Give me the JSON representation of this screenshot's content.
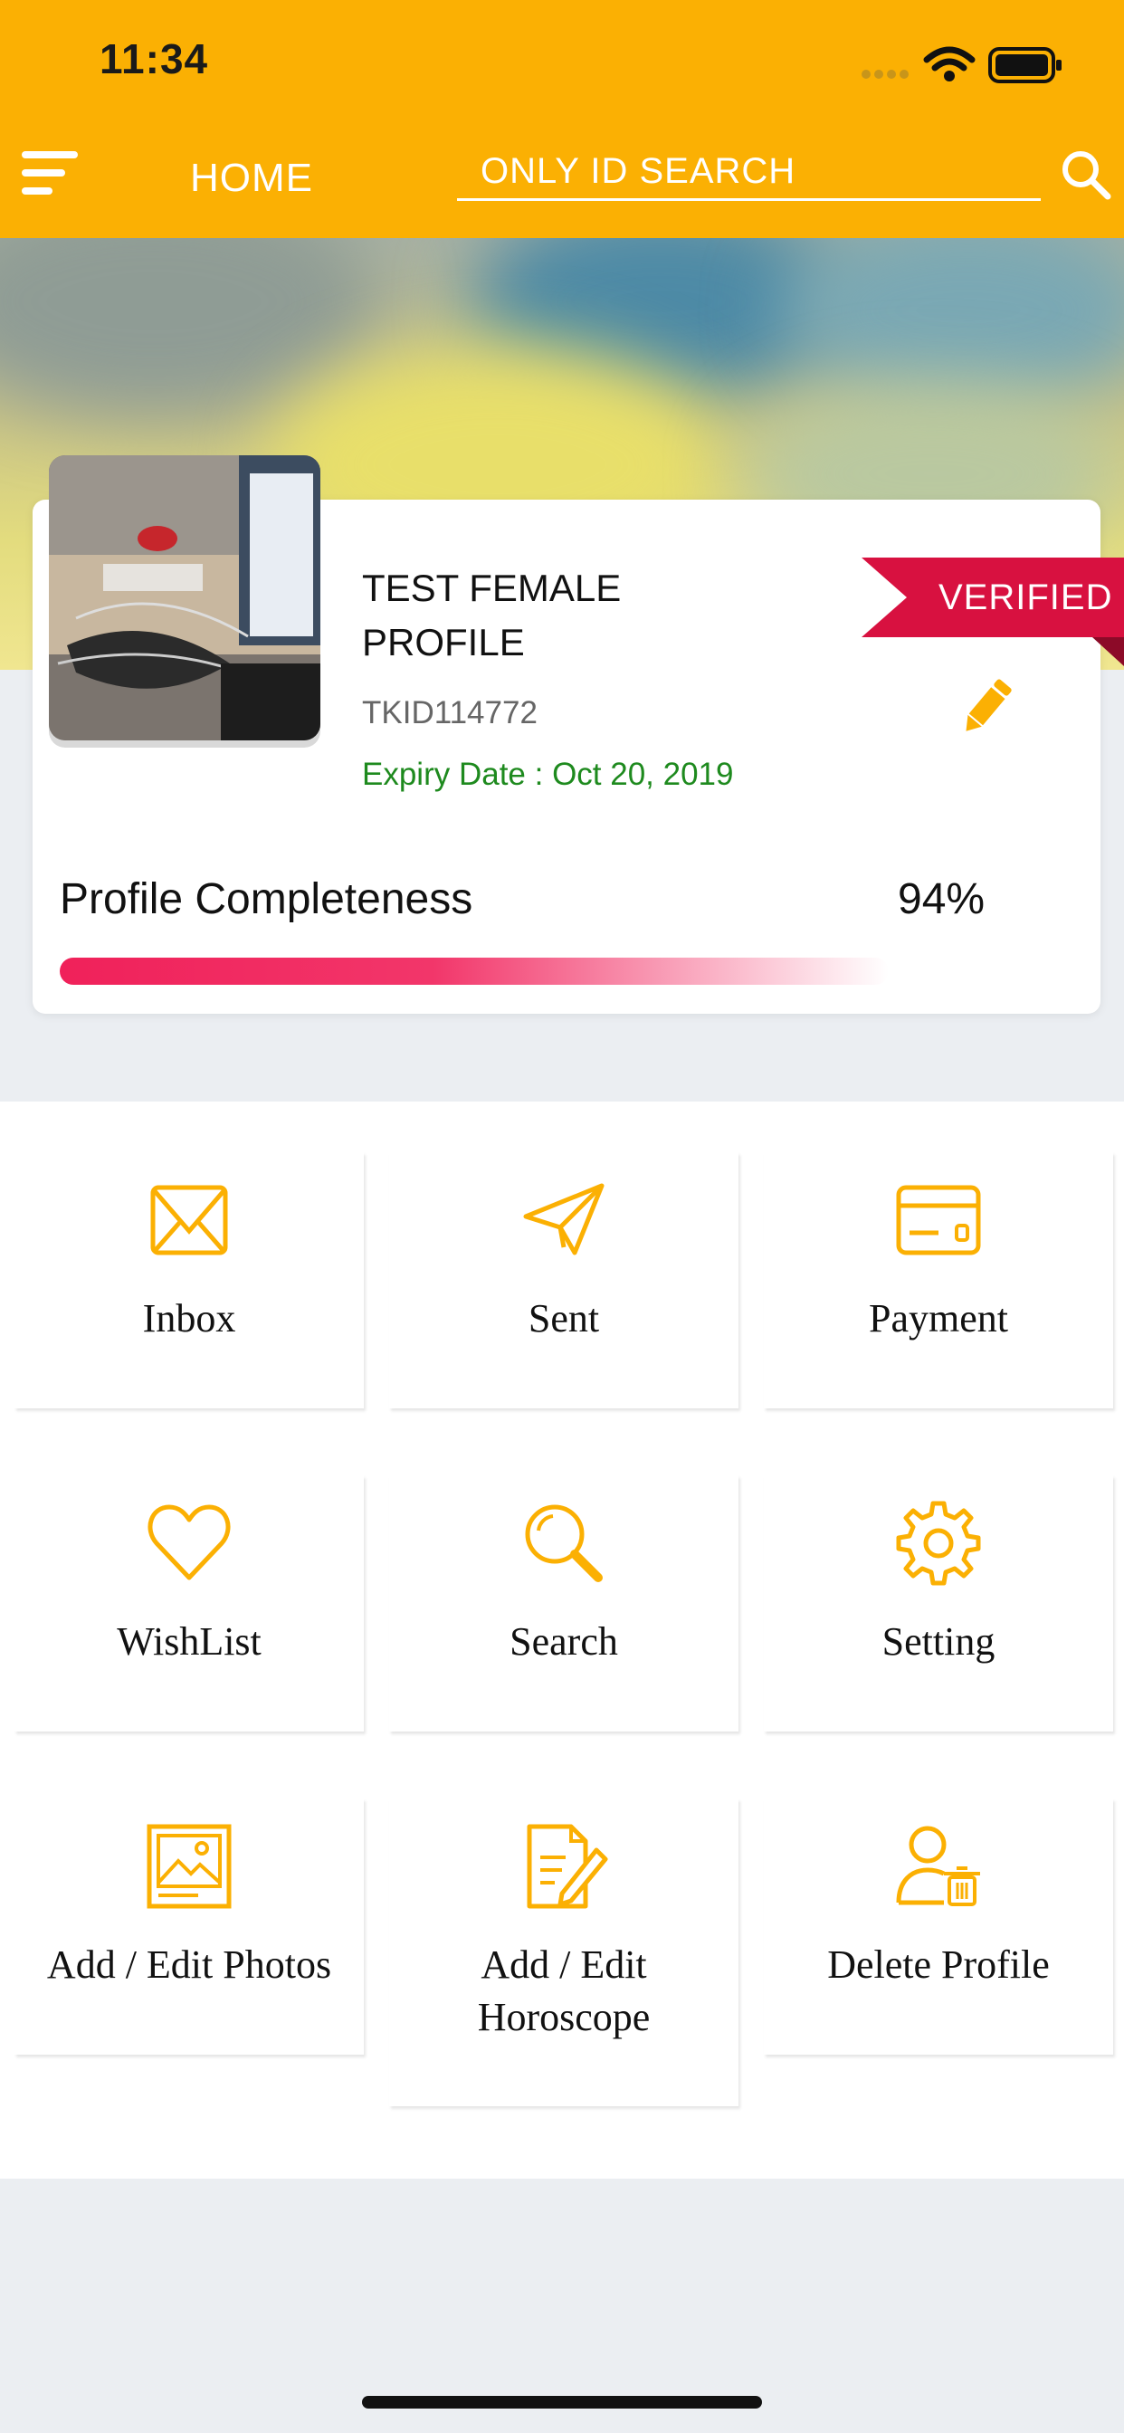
{
  "status_bar": {
    "time": "11:34"
  },
  "header": {
    "title": "HOME",
    "search_placeholder": "ONLY ID SEARCH"
  },
  "profile": {
    "name": "TEST FEMALE PROFILE",
    "id": "TKID114772",
    "expiry": "Expiry Date : Oct 20, 2019",
    "badge": "VERIFIED",
    "completeness_label": "Profile Completeness",
    "completeness_value": "94%",
    "completeness_fraction": 0.94
  },
  "menu": {
    "inbox": "Inbox",
    "sent": "Sent",
    "payment": "Payment",
    "wishlist": "WishList",
    "search": "Search",
    "setting": "Setting",
    "photos": "Add / Edit Photos",
    "horoscope": "Add / Edit Horoscope",
    "delete": "Delete Profile"
  },
  "colors": {
    "accent": "#fbb003",
    "badge": "#d81140",
    "progress": "#f0215a",
    "expiry": "#1e8a1e"
  },
  "icons": [
    "menu-icon",
    "search-icon",
    "pencil-icon",
    "envelope-icon",
    "paper-plane-icon",
    "credit-card-icon",
    "heart-icon",
    "magnifier-icon",
    "gear-icon",
    "image-icon",
    "document-pen-icon",
    "user-delete-icon"
  ]
}
